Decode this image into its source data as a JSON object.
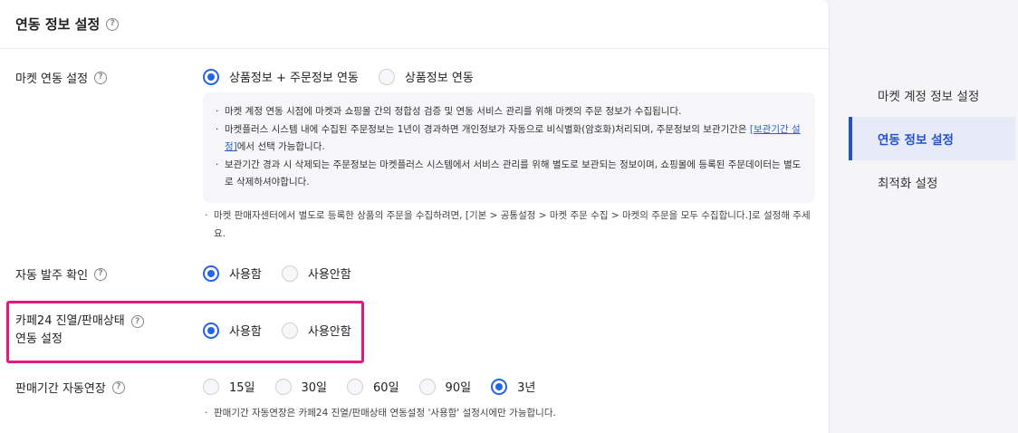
{
  "header": {
    "title": "연동 정보 설정"
  },
  "market_setting": {
    "label": "마켓 연동 설정",
    "options": [
      "상품정보 + 주문정보 연동",
      "상품정보 연동"
    ],
    "info": {
      "line1": "마켓 계정 연동 시점에 마켓과 쇼핑몰 간의 정합성 검증 및 연동 서비스 관리를 위해 마켓의 주문 정보가 수집됩니다.",
      "line2a": "마켓플러스 시스템 내에 수집된 주문정보는 1년이 경과하면 개인정보가 자동으로 비식별화(암호화)처리되며, 주문정보의 보관기간은 ",
      "line2_link": "[보관기간 설정]",
      "line2b": "에서 선택 가능합니다.",
      "line3": "보관기간 경과 시 삭제되는 주문정보는 마켓플러스 시스템에서 서비스 관리를 위해 별도로 보관되는 정보이며, 쇼핑몰에 등록된 주문데이터는 별도로 삭제하셔야합니다."
    },
    "note": "마켓 판매자센터에서 별도로 등록한 상품의 주문을 수집하려면, [기본 > 공통설정 > 마켓 주문 수집 > 마켓의 주문을 모두 수집합니다.]로 설정해 주세요."
  },
  "auto_order": {
    "label": "자동 발주 확인",
    "options": [
      "사용함",
      "사용안함"
    ]
  },
  "cafe24_display": {
    "label_line1": "카페24 진열/판매상태",
    "label_line2": "연동 설정",
    "options": [
      "사용함",
      "사용안함"
    ]
  },
  "sale_period": {
    "label": "판매기간 자동연장",
    "options": [
      "15일",
      "30일",
      "60일",
      "90일",
      "3년"
    ],
    "note": "판매기간 자동연장은 카페24 진열/판매상태 연동설정 '사용함' 설정시에만 가능합니다."
  },
  "side_menu": {
    "items": [
      "마켓 계정 정보 설정",
      "연동 정보 설정",
      "최적화 설정"
    ]
  },
  "colors": {
    "accent": "#2563eb",
    "highlight": "#e5187f"
  }
}
